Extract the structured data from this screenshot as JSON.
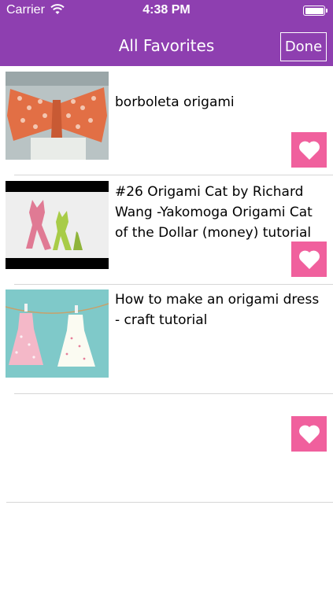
{
  "status_bar": {
    "carrier": "Carrier",
    "time": "4:38 PM",
    "wifi_icon": "wifi-icon",
    "battery_icon": "battery-icon"
  },
  "nav": {
    "title": "All Favorites",
    "done_label": "Done"
  },
  "colors": {
    "nav_bg": "#8e3fb0",
    "heart_bg": "#f0609d"
  },
  "favorites": [
    {
      "title": "borboleta origami",
      "thumbnail": "origami-butterfly-thumbnail",
      "favorite_icon": "heart-icon"
    },
    {
      "title": "#26 Origami Cat by Richard Wang -Yakomoga Origami Cat of the Dollar (money) tutorial",
      "thumbnail": "origami-cat-thumbnail",
      "favorite_icon": "heart-icon"
    },
    {
      "title": "How to make an origami dress - craft tutorial",
      "thumbnail": "origami-dress-thumbnail",
      "favorite_icon": "heart-icon"
    }
  ]
}
